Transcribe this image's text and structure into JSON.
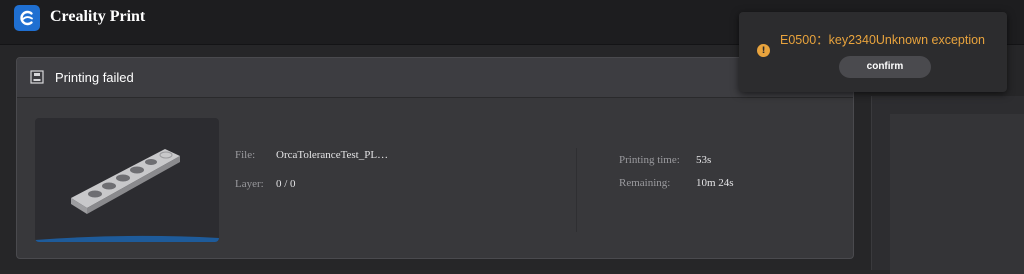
{
  "app": {
    "title": "Creality Print",
    "logo_icon": "creality-logo-icon"
  },
  "print_panel": {
    "status": "Printing failed",
    "status_icon": "printer-icon",
    "file_label": "File:",
    "file_value": "OrcaToleranceTest_PL…",
    "layer_label": "Layer:",
    "layer_value": "0 / 0",
    "printing_time_label": "Printing time:",
    "printing_time_value": "53s",
    "remaining_label": "Remaining:",
    "remaining_value": "10m 24s"
  },
  "error_toast": {
    "icon": "warning-icon",
    "message": "E0500：key2340Unknown exception",
    "confirm_label": "confirm",
    "accent_color": "#e8a33d"
  },
  "colors": {
    "background": "#2a2a2c",
    "titlebar": "#1d1d1f",
    "brand": "#1f6fd1"
  }
}
